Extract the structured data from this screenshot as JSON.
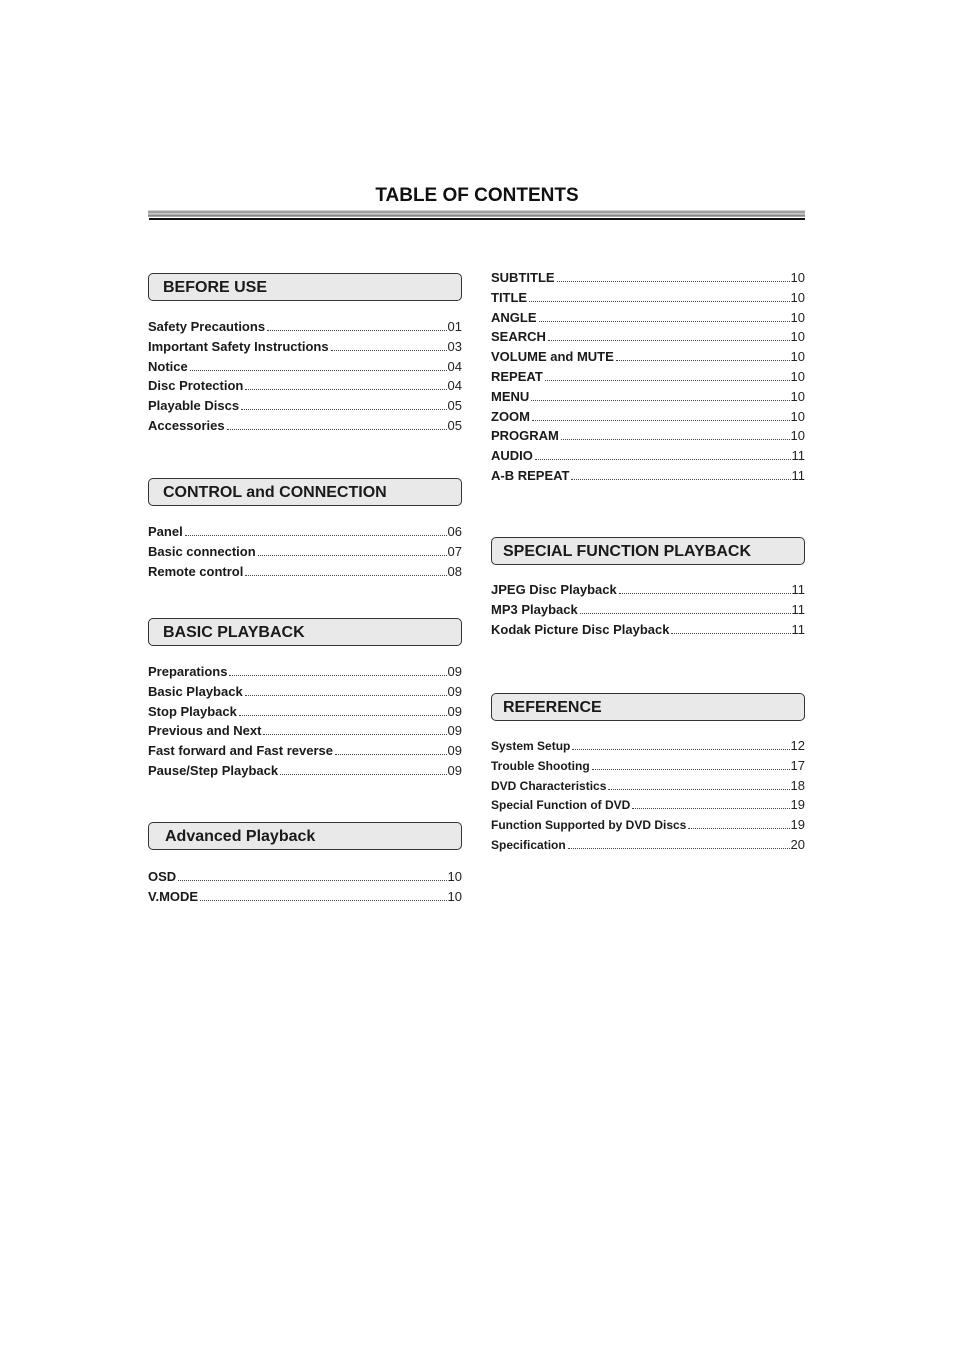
{
  "document": {
    "title": "TABLE OF CONTENTS"
  },
  "left_column": {
    "sections": [
      {
        "heading": "BEFORE USE",
        "entries": [
          {
            "label": "Safety Precautions",
            "page": "01"
          },
          {
            "label": "Important Safety Instructions",
            "page": "03"
          },
          {
            "label": "Notice",
            "page": "04"
          },
          {
            "label": "Disc Protection",
            "page": "04"
          },
          {
            "label": "Playable Discs",
            "page": "05"
          },
          {
            "label": "Accessories",
            "page": "05"
          }
        ]
      },
      {
        "heading": "CONTROL and CONNECTION",
        "entries": [
          {
            "label": "Panel",
            "page": "06"
          },
          {
            "label": "Basic connection",
            "page": "07"
          },
          {
            "label": "Remote control",
            "page": "08"
          }
        ]
      },
      {
        "heading": "BASIC PLAYBACK",
        "entries": [
          {
            "label": "Preparations",
            "page": "09"
          },
          {
            "label": "Basic Playback",
            "page": "09"
          },
          {
            "label": "Stop Playback",
            "page": "09"
          },
          {
            "label": "Previous and Next",
            "page": "09"
          },
          {
            "label": "Fast forward and Fast reverse",
            "page": "09"
          },
          {
            "label": "Pause/Step Playback",
            "page": "09"
          }
        ]
      },
      {
        "heading": "Advanced Playback",
        "entries": [
          {
            "label": "OSD",
            "page": "10"
          },
          {
            "label": "V.MODE",
            "page": "10"
          }
        ]
      }
    ]
  },
  "right_column": {
    "continued_entries": [
      {
        "label": "SUBTITLE",
        "page": "10"
      },
      {
        "label": "TITLE",
        "page": "10"
      },
      {
        "label": "ANGLE",
        "page": "10"
      },
      {
        "label": "SEARCH",
        "page": "10"
      },
      {
        "label": "VOLUME and MUTE",
        "page": "10"
      },
      {
        "label": "REPEAT",
        "page": "10"
      },
      {
        "label": "MENU",
        "page": "10"
      },
      {
        "label": "ZOOM",
        "page": "10"
      },
      {
        "label": "PROGRAM",
        "page": "10"
      },
      {
        "label": "AUDIO",
        "page": "11"
      },
      {
        "label": "A-B REPEAT",
        "page": "11"
      }
    ],
    "sections": [
      {
        "heading": "SPECIAL FUNCTION PLAYBACK",
        "entries": [
          {
            "label": "JPEG Disc Playback",
            "page": "11"
          },
          {
            "label": "MP3 Playback",
            "page": "11"
          },
          {
            "label": "Kodak Picture Disc Playback",
            "page": "11"
          }
        ]
      },
      {
        "heading": "REFERENCE",
        "entries": [
          {
            "label": "System Setup",
            "page": "12"
          },
          {
            "label": "Trouble Shooting",
            "page": "17"
          },
          {
            "label": "DVD Characteristics",
            "page": "18"
          },
          {
            "label": "Special Function of DVD",
            "page": "19"
          },
          {
            "label": "Function Supported by DVD Discs",
            "page": "19"
          },
          {
            "label": "Specification",
            "page": "20"
          }
        ]
      }
    ]
  }
}
